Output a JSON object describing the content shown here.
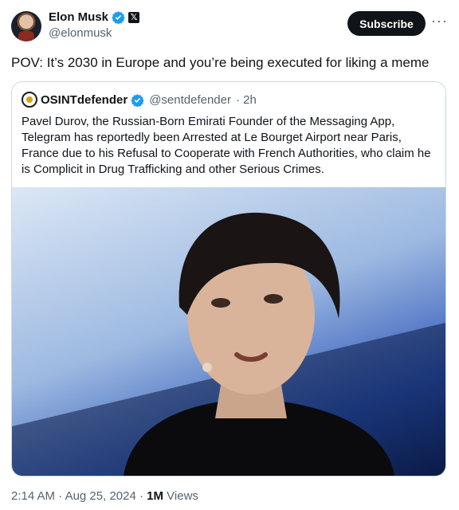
{
  "author": {
    "name": "Elon Musk",
    "handle": "@elonmusk",
    "subscribe_label": "Subscribe",
    "more_label": "···"
  },
  "tweet": {
    "text": "POV: It’s 2030 in Europe and you’re being executed for liking a meme"
  },
  "quoted": {
    "name": "OSINTdefender",
    "handle": "@sentdefender",
    "age": "· 2h",
    "text": "Pavel Durov, the Russian-Born Emirati Founder of the Messaging App, Telegram has reportedly been Arrested at Le Bourget Airport near Paris, France due to his Refusal to Cooperate with French Authorities, who claim he is Complicit in Drug Trafficking and other Serious Crimes."
  },
  "meta": {
    "time": "2:14 AM",
    "date": "Aug 25, 2024",
    "views_count": "1M",
    "views_label": "Views"
  },
  "colors": {
    "verified": "#1d9bf0",
    "secondary_text": "#536471",
    "border": "#cfd9de"
  }
}
